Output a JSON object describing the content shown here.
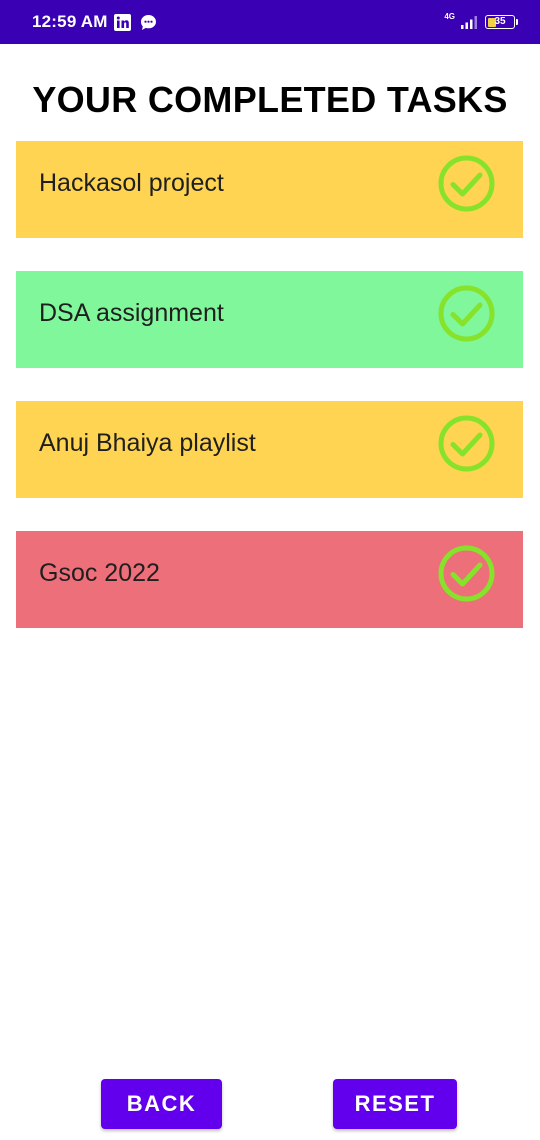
{
  "status_bar": {
    "time": "12:59 AM",
    "network": "4G",
    "battery": "35",
    "battery_level_percent": 35,
    "background_color": "#3a00b4"
  },
  "page_title": "YOUR COMPLETED TASKS",
  "tasks": [
    {
      "label": "Hackasol project",
      "color": "#ffd452",
      "icon": "check-circle-icon"
    },
    {
      "label": "DSA assignment",
      "color": "#7ff79a",
      "icon": "check-circle-icon"
    },
    {
      "label": "Anuj Bhaiya playlist",
      "color": "#ffd452",
      "icon": "check-circle-icon"
    },
    {
      "label": "Gsoc 2022",
      "color": "#ed6f7a",
      "icon": "check-circle-icon"
    }
  ],
  "check_color": "#86e22a",
  "buttons": {
    "back_label": "BACK",
    "reset_label": "RESET",
    "color": "#6200ee"
  }
}
